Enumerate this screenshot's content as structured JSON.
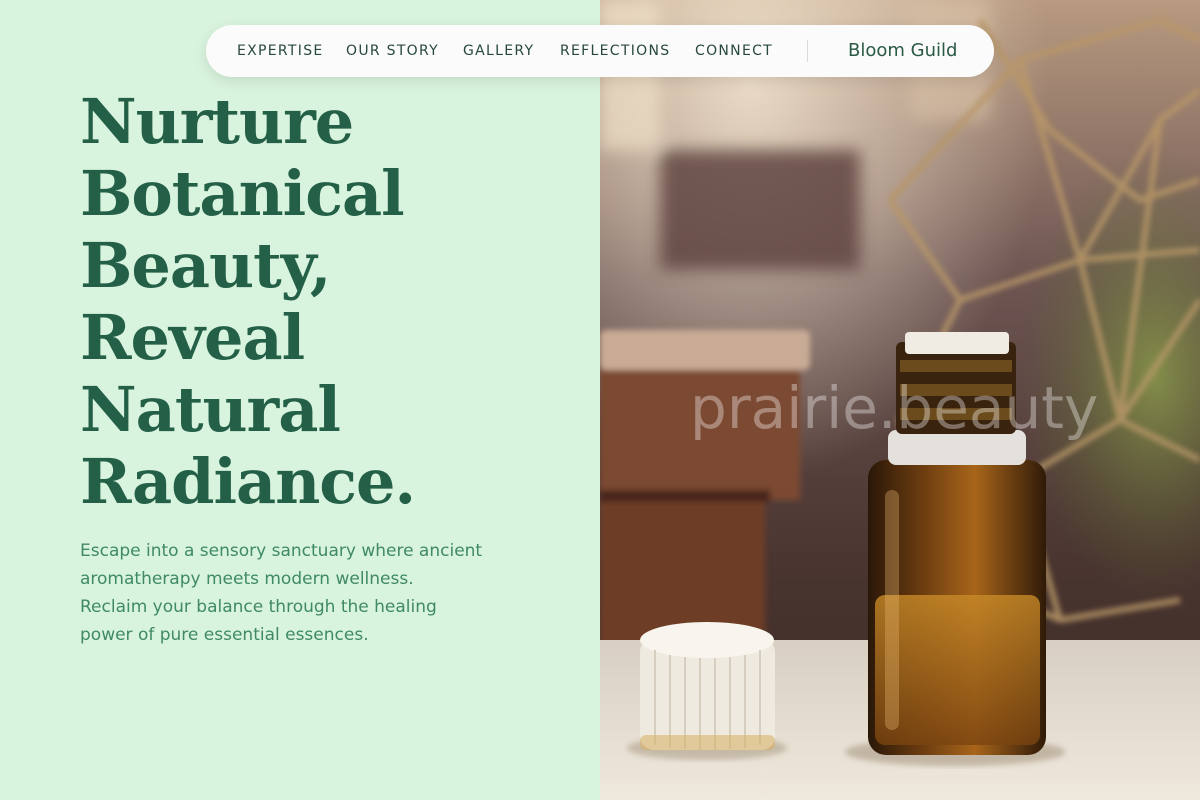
{
  "nav": {
    "links": [
      "EXPERTISE",
      "OUR STORY",
      "GALLERY",
      "REFLECTIONS",
      "CONNECT"
    ],
    "brand": "Bloom Guild"
  },
  "hero": {
    "headline_lines": [
      "Nurture",
      "Botanical",
      "Beauty,",
      "Reveal",
      "Natural",
      "Radiance."
    ],
    "subtext_lines": [
      "Escape into a sensory sanctuary where ancient",
      "aromatherapy meets modern wellness.",
      "Reclaim your balance through the healing",
      "power of pure essential essences."
    ]
  },
  "photo": {
    "watermark": "prairie.beauty",
    "subjects": [
      "amber-essential-oil-bottle",
      "white-bottle-cap",
      "brass-geometric-planter",
      "woven-basket"
    ]
  },
  "colors": {
    "left_background": "#d8f3de",
    "headline": "#246047",
    "subtext": "#3f8a64",
    "nav_background": "#fafbfa",
    "nav_text": "#27483a",
    "brand": "#2a5a44"
  }
}
